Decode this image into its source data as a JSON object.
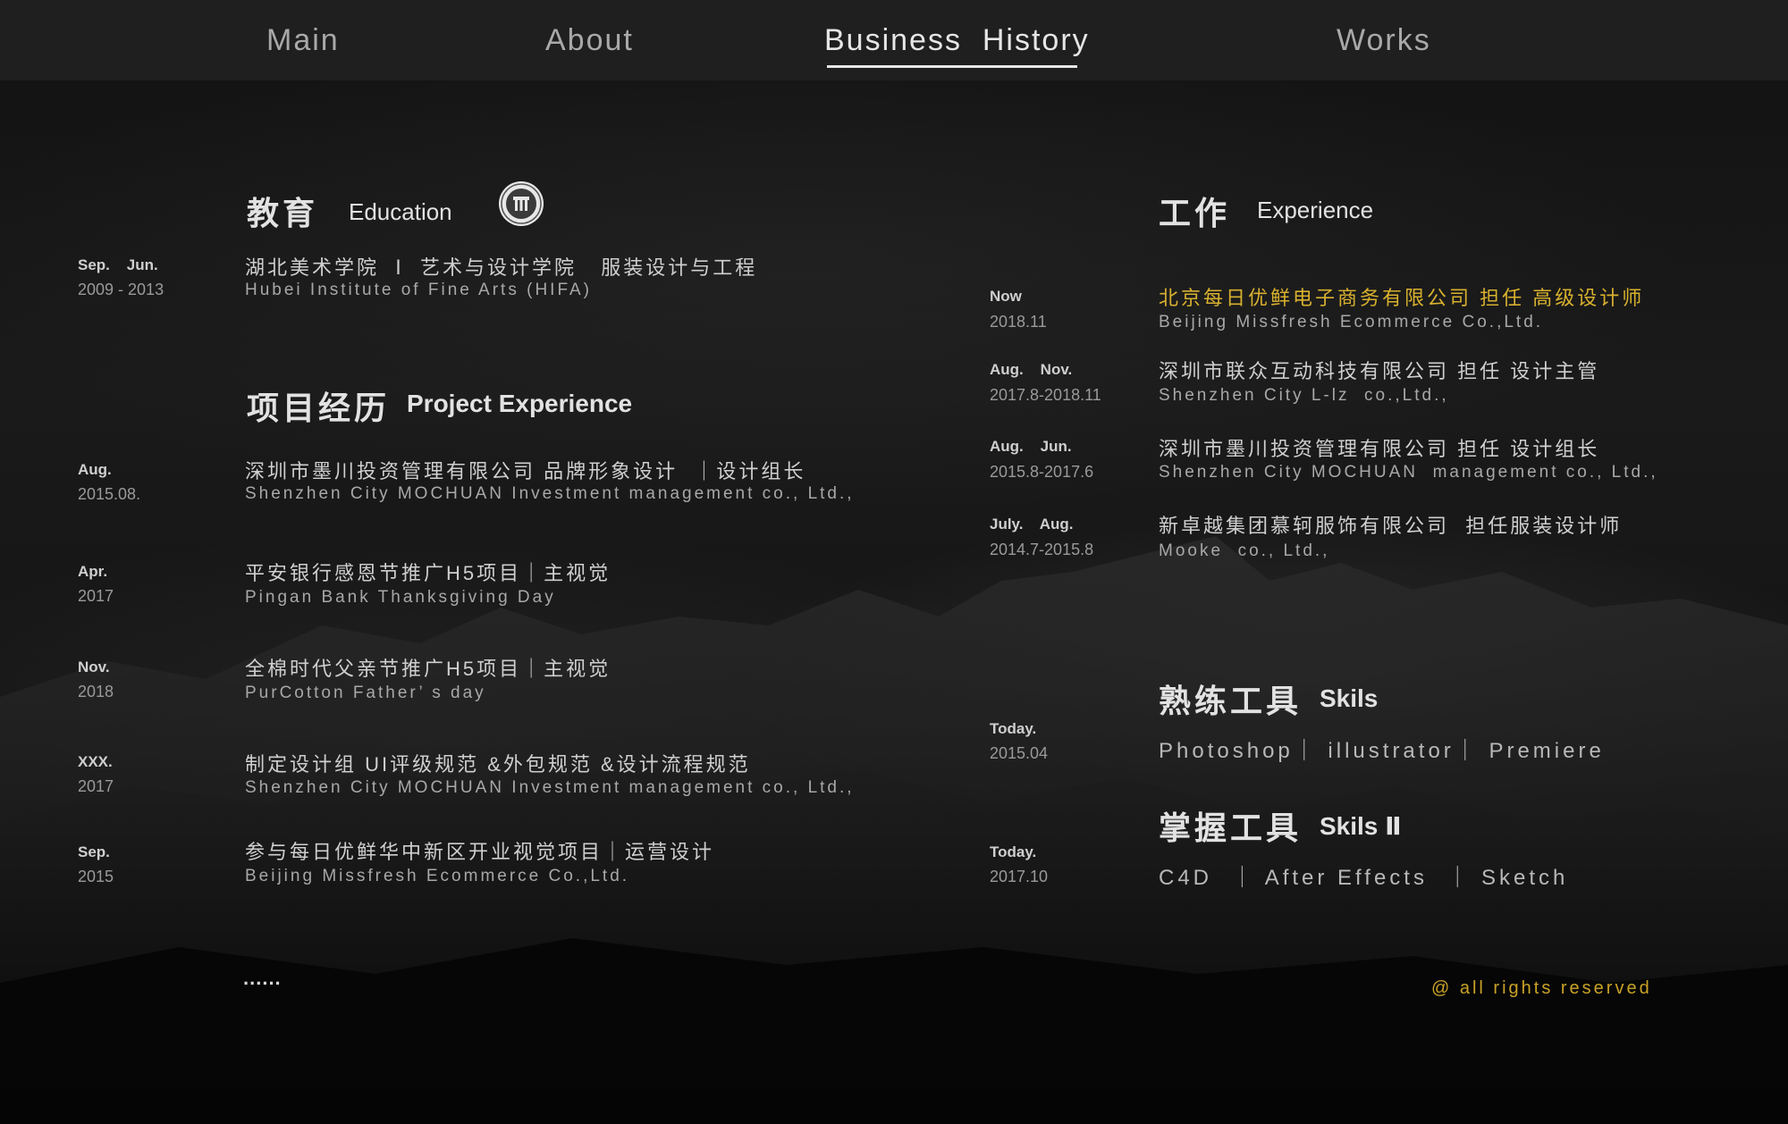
{
  "nav": {
    "items": [
      {
        "label": "Main"
      },
      {
        "label": "About"
      },
      {
        "label": "Business  History"
      },
      {
        "label": "Works"
      }
    ]
  },
  "education": {
    "title_cn": "教育",
    "title_en": "Education",
    "entries": [
      {
        "date_top": "Sep.    Jun.",
        "date_bottom": "2009 - 2013",
        "cn": "湖北美术学院  Ⅰ  艺术与设计学院   服装设计与工程",
        "en": "Hubei Institute of Fine Arts (HIFA)"
      }
    ]
  },
  "projects": {
    "title_cn": "项目经历",
    "title_en": "Project Experience",
    "entries": [
      {
        "date_top": "Aug.",
        "date_bottom": "2015.08.",
        "cn": "深圳市墨川投资管理有限公司 品牌形象设计  ｜设计组长",
        "en": "Shenzhen City MOCHUAN Investment management co., Ltd.,"
      },
      {
        "date_top": "Apr.",
        "date_bottom": "2017",
        "cn": "平安银行感恩节推广H5项目｜主视觉",
        "en": "Pingan Bank Thanksgiving Day"
      },
      {
        "date_top": "Nov.",
        "date_bottom": "2018",
        "cn": "全棉时代父亲节推广H5项目｜主视觉",
        "en": "PurCotton Father’ s day"
      },
      {
        "date_top": "XXX.",
        "date_bottom": "2017",
        "cn": "制定设计组 UI评级规范 &外包规范 &设计流程规范",
        "en": "Shenzhen City MOCHUAN Investment management co., Ltd.,"
      },
      {
        "date_top": "Sep.",
        "date_bottom": "2015",
        "cn": "参与每日优鲜华中新区开业视觉项目｜运营设计",
        "en": "Beijing Missfresh Ecommerce Co.,Ltd."
      }
    ],
    "more": "......"
  },
  "experience": {
    "title_cn": "工作",
    "title_en": "Experience",
    "entries": [
      {
        "date_top": "Now",
        "date_bottom": "2018.11",
        "cn": "北京每日优鲜电子商务有限公司 担任 高级设计师",
        "en": "Beijing Missfresh Ecommerce Co.,Ltd.",
        "highlight": true
      },
      {
        "date_top": "Aug.    Nov.",
        "date_bottom": "2017.8-2018.11",
        "cn": "深圳市联众互动科技有限公司 担任 设计主管",
        "en": "Shenzhen City L-lz  co.,Ltd.,"
      },
      {
        "date_top": "Aug.    Jun.",
        "date_bottom": "2015.8-2017.6",
        "cn": "深圳市墨川投资管理有限公司 担任 设计组长",
        "en": "Shenzhen City MOCHUAN  management co., Ltd.,"
      },
      {
        "date_top": "July.    Aug.",
        "date_bottom": "2014.7-2015.8",
        "cn": "新卓越集团慕轲服饰有限公司  担任服装设计师",
        "en": "Mooke  co., Ltd.,"
      }
    ]
  },
  "skills": {
    "title_cn": "熟练工具",
    "title_en": "Skils",
    "date_top": "Today.",
    "date_bottom": "2015.04",
    "tools": "Photoshop｜ illustrator｜ Premiere"
  },
  "skills2": {
    "title_cn": "掌握工具",
    "title_en": "Skils Ⅱ",
    "date_top": "Today.",
    "date_bottom": "2017.10",
    "tools": "C4D  ｜ After Effects  ｜ Sketch"
  },
  "footer": {
    "text": "@ all rights reserved"
  },
  "colors": {
    "accent": "#d8b12e",
    "nav_bg": "#1f1f1f",
    "page_bg": "#121212"
  },
  "icons": {
    "education_badge": "university-seal-icon"
  }
}
